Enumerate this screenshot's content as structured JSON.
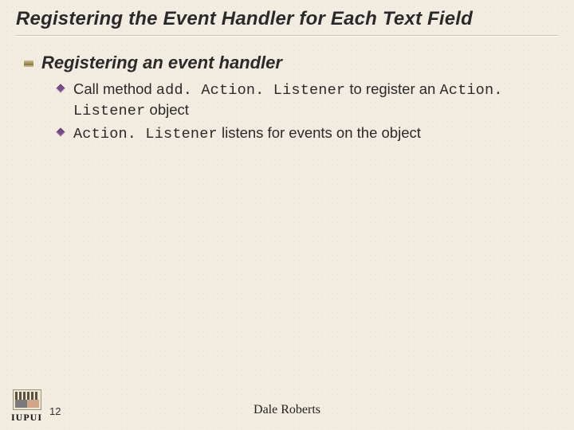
{
  "title": "Registering the Event Handler for Each Text Field",
  "section": {
    "heading": "Registering an event handler",
    "items": [
      {
        "pre": "Call method ",
        "code1": "add. Action. Listener",
        "mid": " to register an ",
        "code2": "Action. Listener",
        "post": " object"
      },
      {
        "pre": "",
        "code1": "Action. Listener",
        "mid": " listens for events on the object",
        "code2": "",
        "post": ""
      }
    ]
  },
  "footer": {
    "logo_text": "IUPUI",
    "page_number": "12",
    "author": "Dale Roberts"
  }
}
